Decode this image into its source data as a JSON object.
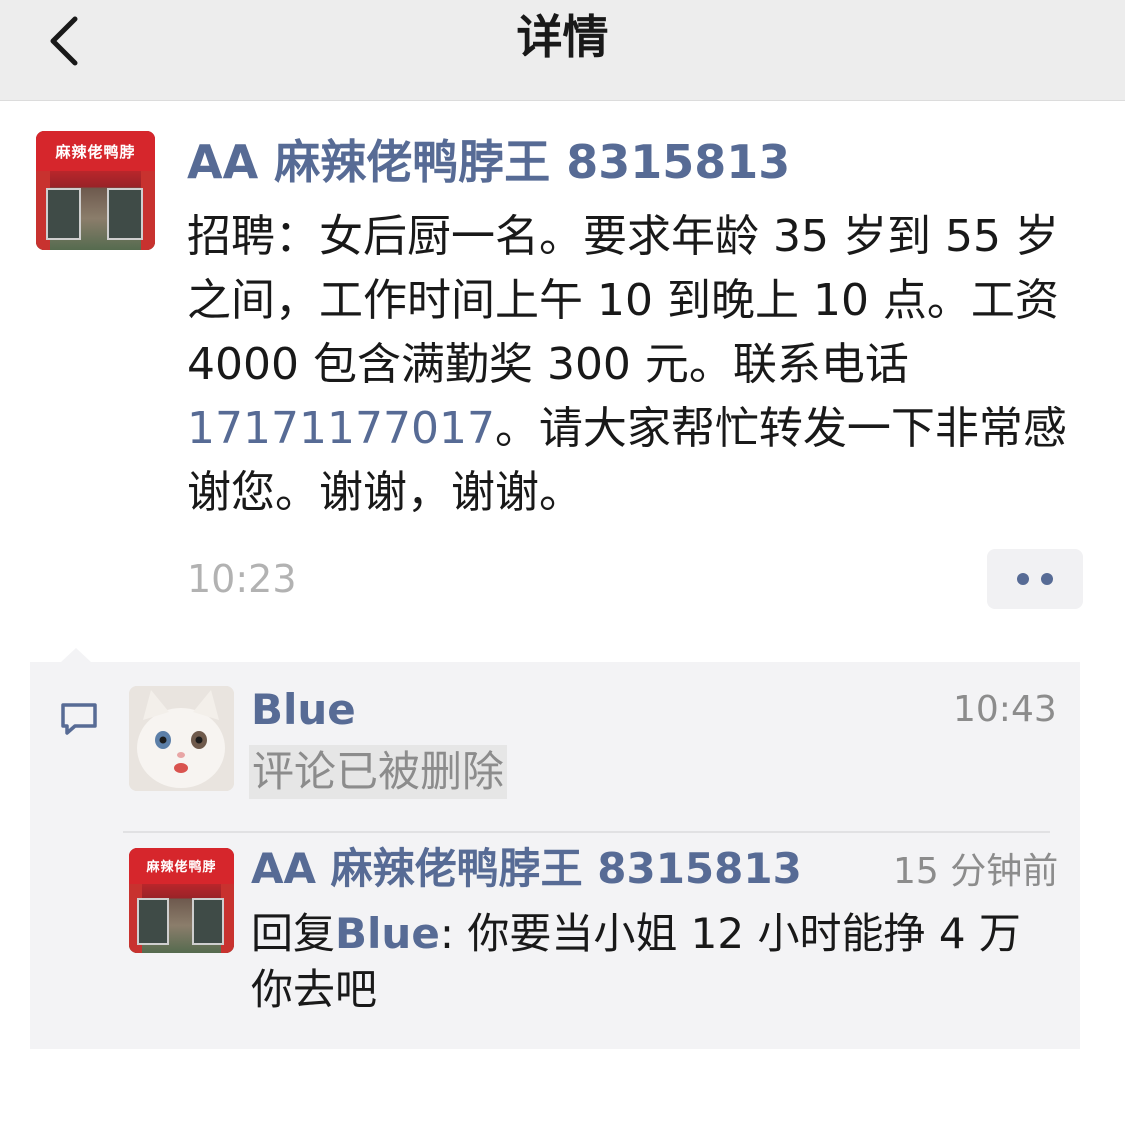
{
  "nav": {
    "back": "back",
    "title": "详情"
  },
  "post": {
    "author": "AA 麻辣佬鸭脖王 8315813",
    "avatar_sign": "麻辣佬鸭脖",
    "text_before_phone": "招聘：女后厨一名。要求年龄 35 岁到 55 岁之间，工作时间上午 10 到晚上 10 点。工资 4000 包含满勤奖 300 元。联系电话",
    "phone": "17171177017",
    "text_after_phone": "。请大家帮忙转发一下非常感谢您。谢谢，谢谢。",
    "time": "10:23"
  },
  "comments": [
    {
      "author": "Blue",
      "time": "10:43",
      "text": "评论已被删除"
    },
    {
      "author": "AA 麻辣佬鸭脖王 8315813",
      "time": "15 分钟前",
      "reply_prefix": "回复",
      "reply_to": "Blue",
      "reply_sep": ": ",
      "text": "你要当小姐 12 小时能挣 4 万你去吧"
    }
  ],
  "colors": {
    "link": "#576b95",
    "navbar": "#ededed",
    "comment_bg": "#f3f3f5"
  },
  "icons": [
    "back-chevron-icon",
    "more-dots-icon",
    "comment-bubble-icon"
  ]
}
